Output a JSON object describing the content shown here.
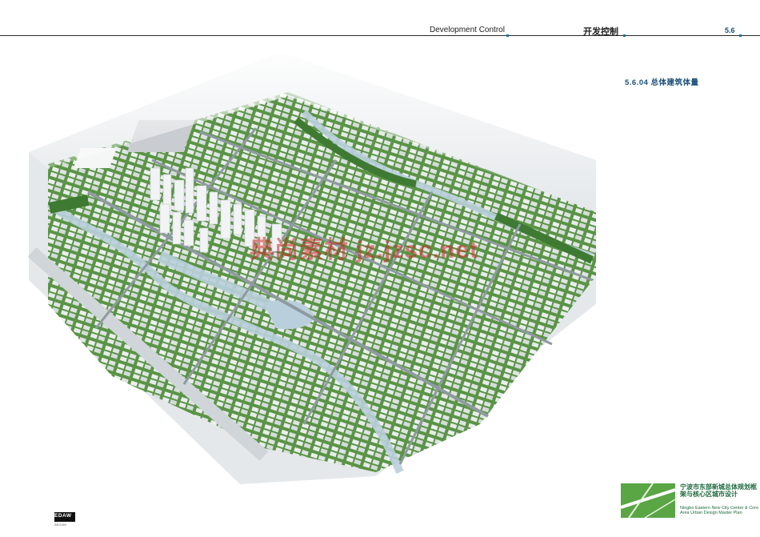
{
  "header": {
    "english_title": "Development Control",
    "chinese_title": "开发控制",
    "section_number": "5.6"
  },
  "section": {
    "title": "5.6.04 总体建筑体量"
  },
  "watermark": {
    "text": "典尚素材 jz.jzsc.net"
  },
  "brand": {
    "title_cn": "宁波市东部新城总体规划框架与核心区城市设计",
    "subtitle_en": "Ningbo Eastern New City Center & Core Area Urban Design Master Plan"
  },
  "firm": {
    "logo_text": "EDAW",
    "small_text": "AECOM"
  },
  "colors": {
    "accent_blue": "#1a4f7a",
    "brand_green": "#4f9a3c",
    "water": "#b9cfdc",
    "vegetation": "#4d8a3a",
    "road": "#8f9aa0"
  }
}
